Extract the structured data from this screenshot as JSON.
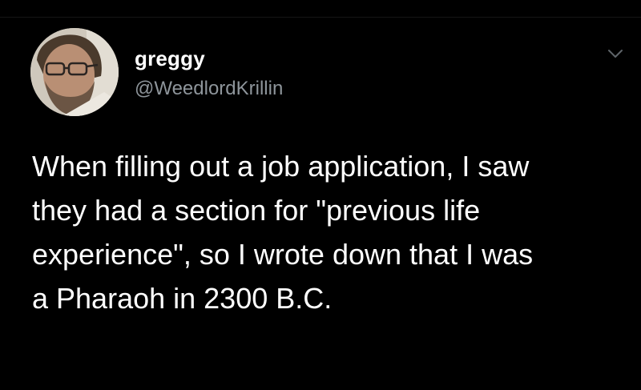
{
  "tweet": {
    "author": {
      "display_name": "greggy",
      "handle": "@WeedlordKrillin",
      "avatar_icon": "user-avatar-photo"
    },
    "menu_icon": "chevron-down-icon",
    "text": "When filling out a job application, I saw\nthey had a section for \"previous life\nexperience\", so I wrote down that I was\na Pharaoh in 2300 B.C."
  },
  "colors": {
    "background": "#000000",
    "text_primary": "#ffffff",
    "text_secondary": "#8e959b",
    "chevron": "#5f656a"
  }
}
